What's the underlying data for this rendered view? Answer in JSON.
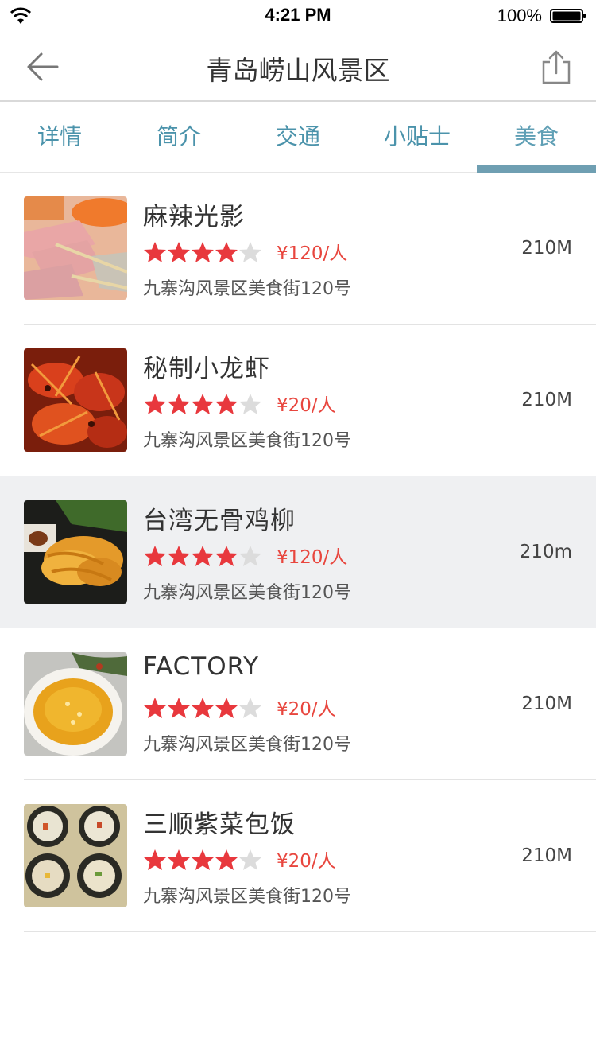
{
  "status_bar": {
    "time": "4:21 PM",
    "battery_percent": "100%"
  },
  "nav": {
    "title": "青岛崂山风景区",
    "back_icon": "arrow-left-icon",
    "share_icon": "share-icon"
  },
  "tabs": [
    {
      "label": "详情",
      "active": false
    },
    {
      "label": "简介",
      "active": false
    },
    {
      "label": "交通",
      "active": false
    },
    {
      "label": "小贴士",
      "active": false
    },
    {
      "label": "美食",
      "active": true
    }
  ],
  "items": [
    {
      "name": "麻辣光影",
      "rating": 4,
      "max_rating": 5,
      "price": "¥120/人",
      "address": "九寨沟风景区美食街120号",
      "distance": "210M",
      "highlighted": false
    },
    {
      "name": "秘制小龙虾",
      "rating": 4,
      "max_rating": 5,
      "price": "¥20/人",
      "address": "九寨沟风景区美食街120号",
      "distance": "210M",
      "highlighted": false
    },
    {
      "name": "台湾无骨鸡柳",
      "rating": 4,
      "max_rating": 5,
      "price": "¥120/人",
      "address": "九寨沟风景区美食街120号",
      "distance": "210m",
      "highlighted": true
    },
    {
      "name": "FACTORY",
      "rating": 4,
      "max_rating": 5,
      "price": "¥20/人",
      "address": "九寨沟风景区美食街120号",
      "distance": "210M",
      "highlighted": false
    },
    {
      "name": "三顺紫菜包饭",
      "rating": 4,
      "max_rating": 5,
      "price": "¥20/人",
      "address": "九寨沟风景区美食街120号",
      "distance": "210M",
      "highlighted": false
    }
  ],
  "colors": {
    "accent": "#6f9fb2",
    "tab_text": "#4b93ab",
    "star_on": "#e8383d",
    "star_off": "#dcdcdc",
    "price": "#e8463e",
    "highlight_bg": "#eff0f2"
  }
}
